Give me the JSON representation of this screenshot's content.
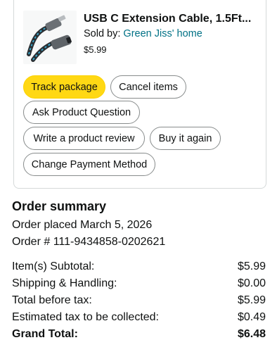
{
  "item": {
    "title": "USB C Extension Cable, 1.5Ft...",
    "seller_prefix": "Sold by: ",
    "seller_name": "Green Jiss' home",
    "price": "$5.99",
    "image_icon": "usb-c-cable-icon"
  },
  "actions": {
    "track": "Track package",
    "cancel": "Cancel items",
    "ask": "Ask Product Question",
    "review": "Write a product review",
    "buy_again": "Buy it again",
    "payment": "Change Payment Method"
  },
  "summary": {
    "title": "Order summary",
    "placed": "Order placed March 5, 2026",
    "order_number": "Order # 111-9434858-0202621",
    "rows": [
      {
        "label": "Item(s) Subtotal:",
        "value": "$5.99"
      },
      {
        "label": "Shipping & Handling:",
        "value": "$0.00"
      },
      {
        "label": "Total before tax:",
        "value": "$5.99"
      },
      {
        "label": "Estimated tax to be collected:",
        "value": "$0.49"
      },
      {
        "label": "Grand Total:",
        "value": "$6.48"
      }
    ]
  },
  "colors": {
    "primary_button": "#ffd814",
    "link": "#007185",
    "border": "#d5d9d9"
  }
}
